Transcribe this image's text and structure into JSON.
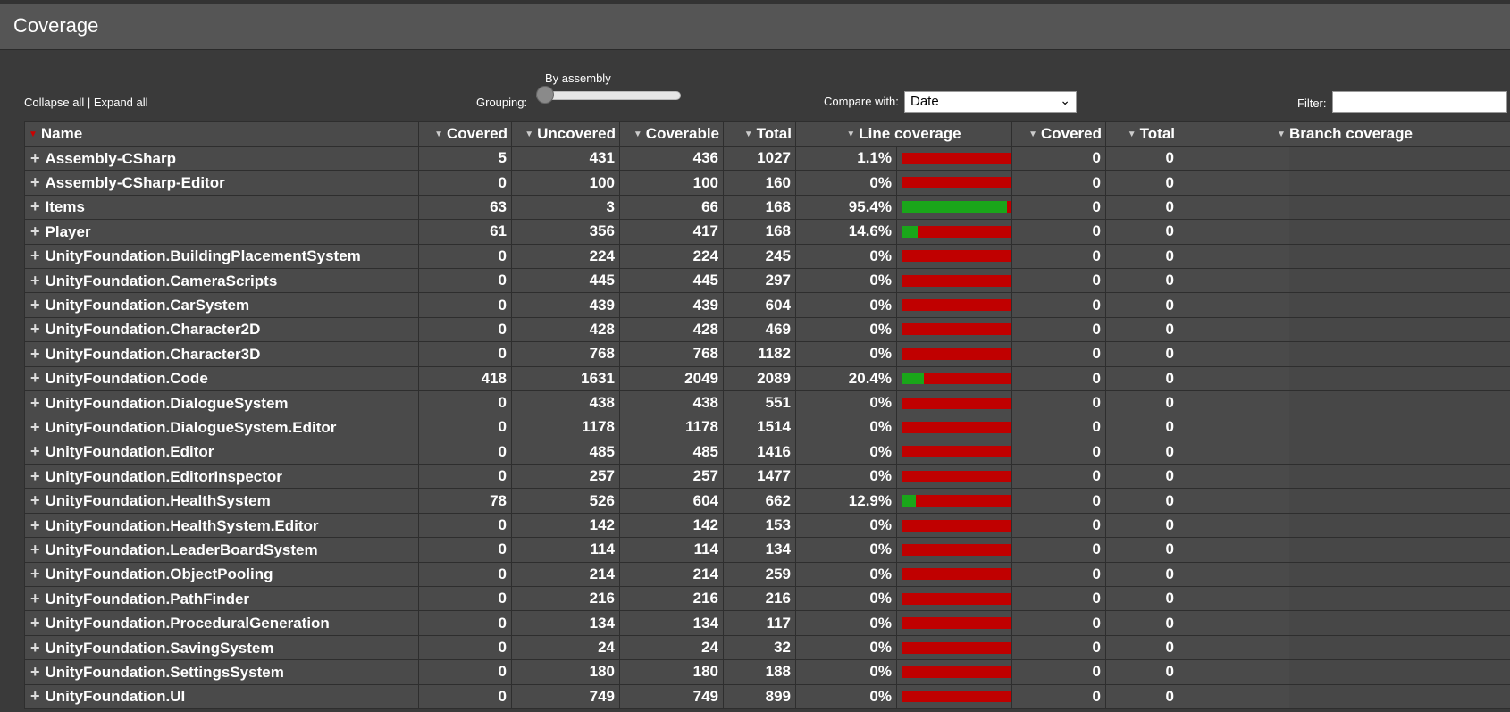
{
  "title": "Coverage",
  "toolbar": {
    "collapse_all": "Collapse all",
    "separator": " | ",
    "expand_all": "Expand all",
    "grouping_label": "Grouping:",
    "grouping_value": "By assembly",
    "grouping_level": 0,
    "compare_label": "Compare with:",
    "compare_value": "Date",
    "filter_label": "Filter:",
    "filter_value": ""
  },
  "headers": {
    "name": "Name",
    "covered": "Covered",
    "uncovered": "Uncovered",
    "coverable": "Coverable",
    "total": "Total",
    "line_coverage": "Line coverage",
    "branch_covered": "Covered",
    "branch_total": "Total",
    "branch_coverage": "Branch coverage"
  },
  "colors": {
    "covered_bar": "#1aa61a",
    "uncovered_bar": "#c00000",
    "sort_active": "#cc0000"
  },
  "rows": [
    {
      "name": "Assembly-CSharp",
      "covered": "5",
      "uncovered": "431",
      "coverable": "436",
      "total": "1027",
      "pct": "1.1%",
      "ratio": 0.011,
      "bcovered": "0",
      "btotal": "0"
    },
    {
      "name": "Assembly-CSharp-Editor",
      "covered": "0",
      "uncovered": "100",
      "coverable": "100",
      "total": "160",
      "pct": "0%",
      "ratio": 0,
      "bcovered": "0",
      "btotal": "0"
    },
    {
      "name": "Items",
      "covered": "63",
      "uncovered": "3",
      "coverable": "66",
      "total": "168",
      "pct": "95.4%",
      "ratio": 0.954,
      "bcovered": "0",
      "btotal": "0"
    },
    {
      "name": "Player",
      "covered": "61",
      "uncovered": "356",
      "coverable": "417",
      "total": "168",
      "pct": "14.6%",
      "ratio": 0.146,
      "bcovered": "0",
      "btotal": "0"
    },
    {
      "name": "UnityFoundation.BuildingPlacementSystem",
      "covered": "0",
      "uncovered": "224",
      "coverable": "224",
      "total": "245",
      "pct": "0%",
      "ratio": 0,
      "bcovered": "0",
      "btotal": "0"
    },
    {
      "name": "UnityFoundation.CameraScripts",
      "covered": "0",
      "uncovered": "445",
      "coverable": "445",
      "total": "297",
      "pct": "0%",
      "ratio": 0,
      "bcovered": "0",
      "btotal": "0"
    },
    {
      "name": "UnityFoundation.CarSystem",
      "covered": "0",
      "uncovered": "439",
      "coverable": "439",
      "total": "604",
      "pct": "0%",
      "ratio": 0,
      "bcovered": "0",
      "btotal": "0"
    },
    {
      "name": "UnityFoundation.Character2D",
      "covered": "0",
      "uncovered": "428",
      "coverable": "428",
      "total": "469",
      "pct": "0%",
      "ratio": 0,
      "bcovered": "0",
      "btotal": "0"
    },
    {
      "name": "UnityFoundation.Character3D",
      "covered": "0",
      "uncovered": "768",
      "coverable": "768",
      "total": "1182",
      "pct": "0%",
      "ratio": 0,
      "bcovered": "0",
      "btotal": "0"
    },
    {
      "name": "UnityFoundation.Code",
      "covered": "418",
      "uncovered": "1631",
      "coverable": "2049",
      "total": "2089",
      "pct": "20.4%",
      "ratio": 0.204,
      "bcovered": "0",
      "btotal": "0"
    },
    {
      "name": "UnityFoundation.DialogueSystem",
      "covered": "0",
      "uncovered": "438",
      "coverable": "438",
      "total": "551",
      "pct": "0%",
      "ratio": 0,
      "bcovered": "0",
      "btotal": "0"
    },
    {
      "name": "UnityFoundation.DialogueSystem.Editor",
      "covered": "0",
      "uncovered": "1178",
      "coverable": "1178",
      "total": "1514",
      "pct": "0%",
      "ratio": 0,
      "bcovered": "0",
      "btotal": "0"
    },
    {
      "name": "UnityFoundation.Editor",
      "covered": "0",
      "uncovered": "485",
      "coverable": "485",
      "total": "1416",
      "pct": "0%",
      "ratio": 0,
      "bcovered": "0",
      "btotal": "0"
    },
    {
      "name": "UnityFoundation.EditorInspector",
      "covered": "0",
      "uncovered": "257",
      "coverable": "257",
      "total": "1477",
      "pct": "0%",
      "ratio": 0,
      "bcovered": "0",
      "btotal": "0"
    },
    {
      "name": "UnityFoundation.HealthSystem",
      "covered": "78",
      "uncovered": "526",
      "coverable": "604",
      "total": "662",
      "pct": "12.9%",
      "ratio": 0.129,
      "bcovered": "0",
      "btotal": "0"
    },
    {
      "name": "UnityFoundation.HealthSystem.Editor",
      "covered": "0",
      "uncovered": "142",
      "coverable": "142",
      "total": "153",
      "pct": "0%",
      "ratio": 0,
      "bcovered": "0",
      "btotal": "0"
    },
    {
      "name": "UnityFoundation.LeaderBoardSystem",
      "covered": "0",
      "uncovered": "114",
      "coverable": "114",
      "total": "134",
      "pct": "0%",
      "ratio": 0,
      "bcovered": "0",
      "btotal": "0"
    },
    {
      "name": "UnityFoundation.ObjectPooling",
      "covered": "0",
      "uncovered": "214",
      "coverable": "214",
      "total": "259",
      "pct": "0%",
      "ratio": 0,
      "bcovered": "0",
      "btotal": "0"
    },
    {
      "name": "UnityFoundation.PathFinder",
      "covered": "0",
      "uncovered": "216",
      "coverable": "216",
      "total": "216",
      "pct": "0%",
      "ratio": 0,
      "bcovered": "0",
      "btotal": "0"
    },
    {
      "name": "UnityFoundation.ProceduralGeneration",
      "covered": "0",
      "uncovered": "134",
      "coverable": "134",
      "total": "117",
      "pct": "0%",
      "ratio": 0,
      "bcovered": "0",
      "btotal": "0"
    },
    {
      "name": "UnityFoundation.SavingSystem",
      "covered": "0",
      "uncovered": "24",
      "coverable": "24",
      "total": "32",
      "pct": "0%",
      "ratio": 0,
      "bcovered": "0",
      "btotal": "0"
    },
    {
      "name": "UnityFoundation.SettingsSystem",
      "covered": "0",
      "uncovered": "180",
      "coverable": "180",
      "total": "188",
      "pct": "0%",
      "ratio": 0,
      "bcovered": "0",
      "btotal": "0"
    },
    {
      "name": "UnityFoundation.UI",
      "covered": "0",
      "uncovered": "749",
      "coverable": "749",
      "total": "899",
      "pct": "0%",
      "ratio": 0,
      "bcovered": "0",
      "btotal": "0"
    }
  ]
}
